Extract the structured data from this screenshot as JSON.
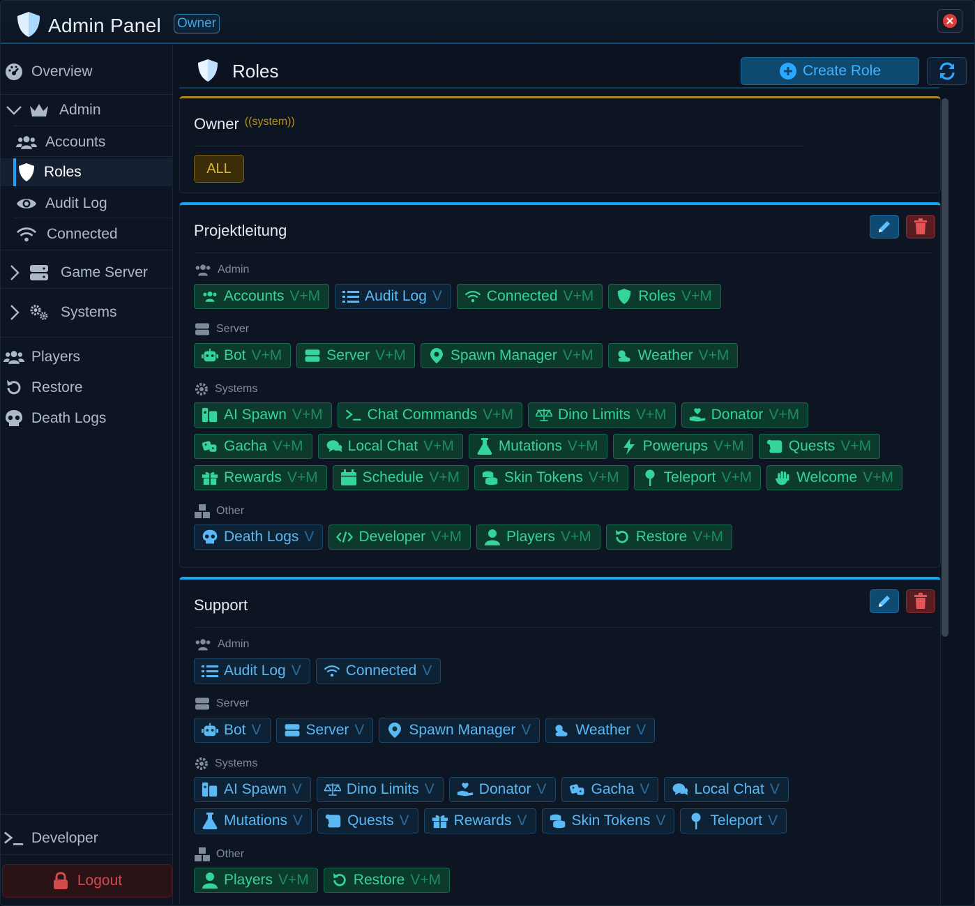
{
  "window": {
    "title": "Admin Panel",
    "badge": "Owner",
    "accent": "#10a8f0"
  },
  "sidebar": {
    "overview": "Overview",
    "admin_group": "Admin",
    "accounts": "Accounts",
    "roles": "Roles",
    "audit_log": "Audit Log",
    "connected": "Connected",
    "game_server": "Game Server",
    "systems": "Systems",
    "players": "Players",
    "restore": "Restore",
    "death_logs": "Death Logs",
    "developer": "Developer",
    "logout": "Logout"
  },
  "header": {
    "title": "Roles",
    "create_label": "Create Role"
  },
  "owner_card": {
    "name": "Owner",
    "tag": "((system))",
    "all_label": "ALL"
  },
  "groups": {
    "admin": "Admin",
    "server": "Server",
    "systems": "Systems",
    "other": "Other"
  },
  "roles": [
    {
      "name": "Projektleitung",
      "admin": [
        {
          "label": "Accounts",
          "perm": "V+M",
          "icon": "users-icon"
        },
        {
          "label": "Audit Log",
          "perm": "V",
          "icon": "list-icon"
        },
        {
          "label": "Connected",
          "perm": "V+M",
          "icon": "wifi-icon"
        },
        {
          "label": "Roles",
          "perm": "V+M",
          "icon": "shield-icon"
        }
      ],
      "server": [
        {
          "label": "Bot",
          "perm": "V+M",
          "icon": "robot-icon"
        },
        {
          "label": "Server",
          "perm": "V+M",
          "icon": "server-icon"
        },
        {
          "label": "Spawn Manager",
          "perm": "V+M",
          "icon": "map-pin-icon"
        },
        {
          "label": "Weather",
          "perm": "V+M",
          "icon": "weather-icon"
        }
      ],
      "systems": [
        [
          {
            "label": "AI Spawn",
            "perm": "V+M",
            "icon": "ai-spawn-icon"
          },
          {
            "label": "Chat Commands",
            "perm": "V+M",
            "icon": "terminal-icon"
          },
          {
            "label": "Dino Limits",
            "perm": "V+M",
            "icon": "scale-icon"
          },
          {
            "label": "Donator",
            "perm": "V+M",
            "icon": "donate-icon"
          }
        ],
        [
          {
            "label": "Gacha",
            "perm": "V+M",
            "icon": "dice-icon"
          },
          {
            "label": "Local Chat",
            "perm": "V+M",
            "icon": "comments-icon"
          },
          {
            "label": "Mutations",
            "perm": "V+M",
            "icon": "flask-icon"
          },
          {
            "label": "Powerups",
            "perm": "V+M",
            "icon": "bolt-icon"
          },
          {
            "label": "Quests",
            "perm": "V+M",
            "icon": "scroll-icon"
          }
        ],
        [
          {
            "label": "Rewards",
            "perm": "V+M",
            "icon": "gift-icon"
          },
          {
            "label": "Schedule",
            "perm": "V+M",
            "icon": "calendar-icon"
          },
          {
            "label": "Skin Tokens",
            "perm": "V+M",
            "icon": "coins-icon"
          },
          {
            "label": "Teleport",
            "perm": "V+M",
            "icon": "pushpin-icon"
          },
          {
            "label": "Welcome",
            "perm": "V+M",
            "icon": "wave-hand-icon"
          }
        ]
      ],
      "other": [
        {
          "label": "Death Logs",
          "perm": "V",
          "icon": "skull-icon"
        },
        {
          "label": "Developer",
          "perm": "V+M",
          "icon": "code-icon"
        },
        {
          "label": "Players",
          "perm": "V+M",
          "icon": "user-icon"
        },
        {
          "label": "Restore",
          "perm": "V+M",
          "icon": "restore-icon"
        }
      ]
    },
    {
      "name": "Support",
      "admin": [
        {
          "label": "Audit Log",
          "perm": "V",
          "icon": "list-icon"
        },
        {
          "label": "Connected",
          "perm": "V",
          "icon": "wifi-icon"
        }
      ],
      "server": [
        {
          "label": "Bot",
          "perm": "V",
          "icon": "robot-icon"
        },
        {
          "label": "Server",
          "perm": "V",
          "icon": "server-icon"
        },
        {
          "label": "Spawn Manager",
          "perm": "V",
          "icon": "map-pin-icon"
        },
        {
          "label": "Weather",
          "perm": "V",
          "icon": "weather-icon"
        }
      ],
      "systems": [
        [
          {
            "label": "AI Spawn",
            "perm": "V",
            "icon": "ai-spawn-icon"
          },
          {
            "label": "Dino Limits",
            "perm": "V",
            "icon": "scale-icon"
          },
          {
            "label": "Donator",
            "perm": "V",
            "icon": "donate-icon"
          },
          {
            "label": "Gacha",
            "perm": "V",
            "icon": "dice-icon"
          },
          {
            "label": "Local Chat",
            "perm": "V",
            "icon": "comments-icon"
          }
        ],
        [
          {
            "label": "Mutations",
            "perm": "V",
            "icon": "flask-icon"
          },
          {
            "label": "Quests",
            "perm": "V",
            "icon": "scroll-icon"
          },
          {
            "label": "Rewards",
            "perm": "V",
            "icon": "gift-icon"
          },
          {
            "label": "Skin Tokens",
            "perm": "V",
            "icon": "coins-icon"
          },
          {
            "label": "Teleport",
            "perm": "V",
            "icon": "pushpin-icon"
          }
        ]
      ],
      "other": [
        {
          "label": "Players",
          "perm": "V+M",
          "icon": "user-icon"
        },
        {
          "label": "Restore",
          "perm": "V+M",
          "icon": "restore-icon"
        }
      ]
    }
  ]
}
